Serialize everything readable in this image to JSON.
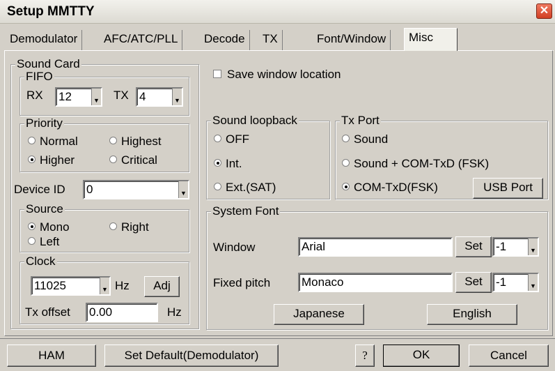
{
  "window": {
    "title": "Setup MMTTY",
    "close": "✕"
  },
  "tabs": [
    "Demodulator",
    "AFC/ATC/PLL",
    "Decode",
    "TX",
    "Font/Window",
    "Misc"
  ],
  "sound_card": {
    "title": "Sound Card",
    "fifo": {
      "title": "FIFO",
      "rx_label": "RX",
      "rx_value": "12",
      "tx_label": "TX",
      "tx_value": "4"
    },
    "priority": {
      "title": "Priority",
      "normal": "Normal",
      "highest": "Highest",
      "higher": "Higher",
      "critical": "Critical",
      "selected": "Higher"
    },
    "device_id": {
      "label": "Device ID",
      "value": "0"
    },
    "source": {
      "title": "Source",
      "mono": "Mono",
      "right": "Right",
      "left": "Left",
      "selected": "Mono"
    },
    "clock": {
      "title": "Clock",
      "value": "11025",
      "unit": "Hz",
      "adj": "Adj",
      "tx_offset_label": "Tx offset",
      "tx_offset_value": "0.00",
      "tx_offset_unit": "Hz"
    }
  },
  "save_window_location": {
    "label": "Save window location",
    "checked": false
  },
  "sound_loopback": {
    "title": "Sound loopback",
    "off": "OFF",
    "int": "Int.",
    "ext": "Ext.(SAT)",
    "selected": "Int."
  },
  "tx_port": {
    "title": "Tx Port",
    "sound": "Sound",
    "sound_com": "Sound + COM-TxD (FSK)",
    "com": "COM-TxD(FSK)",
    "usb": "USB Port",
    "selected": "COM-TxD(FSK)"
  },
  "system_font": {
    "title": "System Font",
    "window_label": "Window",
    "window_value": "Arial",
    "window_set": "Set",
    "window_size": "-1",
    "fixed_label": "Fixed pitch",
    "fixed_value": "Monaco",
    "fixed_set": "Set",
    "fixed_size": "-1",
    "japanese": "Japanese",
    "english": "English"
  },
  "footer": {
    "ham": "HAM",
    "set_default": "Set Default(Demodulator)",
    "help": "?",
    "ok": "OK",
    "cancel": "Cancel"
  }
}
